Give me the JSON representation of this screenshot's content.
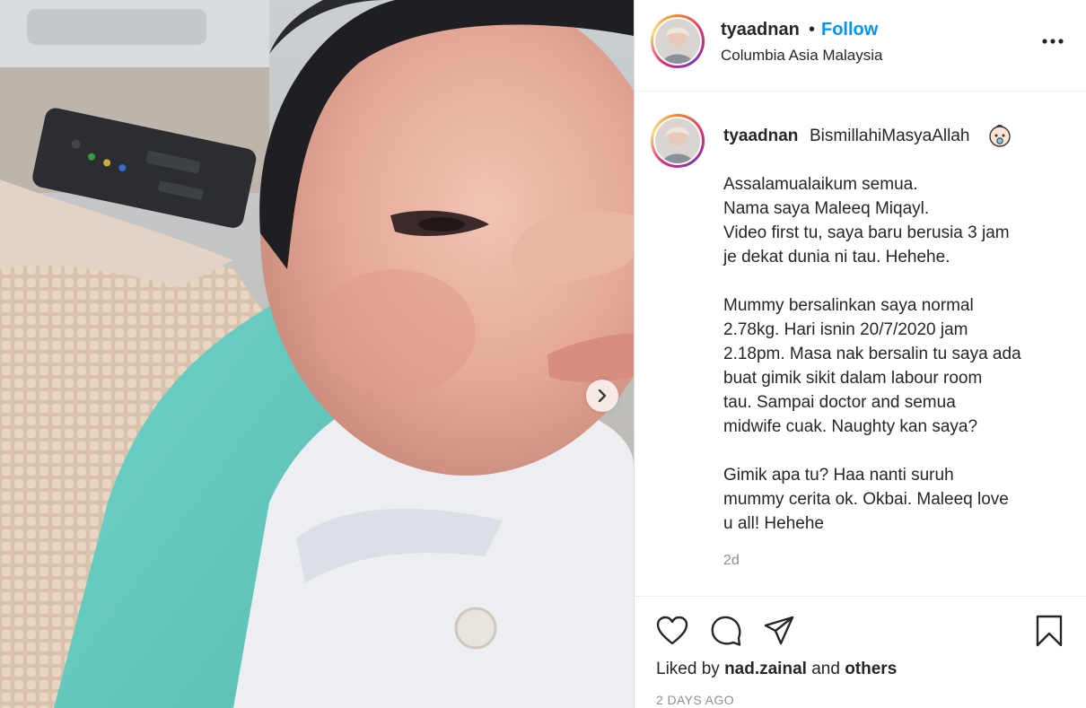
{
  "post": {
    "username": "tyaadnan",
    "separator": "•",
    "follow_label": "Follow",
    "location": "Columbia Asia Malaysia",
    "more_icon": "more-options-icon",
    "media_alt": "Newborn baby wrapped in white clothes and a teal towel",
    "next_icon": "chevron-right-icon"
  },
  "caption": {
    "username": "tyaadnan",
    "first_line": "BismillahiMasyaAllah",
    "emoji_icon": "baby-face-icon",
    "paragraphs": [
      {
        "l1": "Assalamualaikum semua.",
        "l2": "Nama saya Maleeq Miqayl.",
        "l3": "Video first tu, saya baru berusia 3 jam",
        "l4": "je dekat dunia ni tau. Hehehe."
      },
      {
        "l1": "Mummy bersalinkan saya normal",
        "l2": "2.78kg. Hari isnin 20/7/2020 jam",
        "l3": "2.18pm. Masa nak bersalin tu saya ada",
        "l4": "buat gimik sikit dalam labour room",
        "l5": "tau. Sampai doctor and semua",
        "l6": "midwife cuak. Naughty kan saya?"
      },
      {
        "l1": "Gimik apa tu? Haa nanti suruh",
        "l2": "mummy cerita ok. Okbai. Maleeq love",
        "l3": "u all! Hehehe"
      }
    ],
    "time": "2d"
  },
  "actions": {
    "like_icon": "heart-icon",
    "comment_icon": "comment-icon",
    "share_icon": "share-icon",
    "save_icon": "bookmark-icon",
    "liked_by_prefix": "Liked by",
    "liked_by_user": "nad.zainal",
    "liked_by_and": "and",
    "liked_by_others": "others",
    "posted_ago": "2 DAYS AGO"
  }
}
